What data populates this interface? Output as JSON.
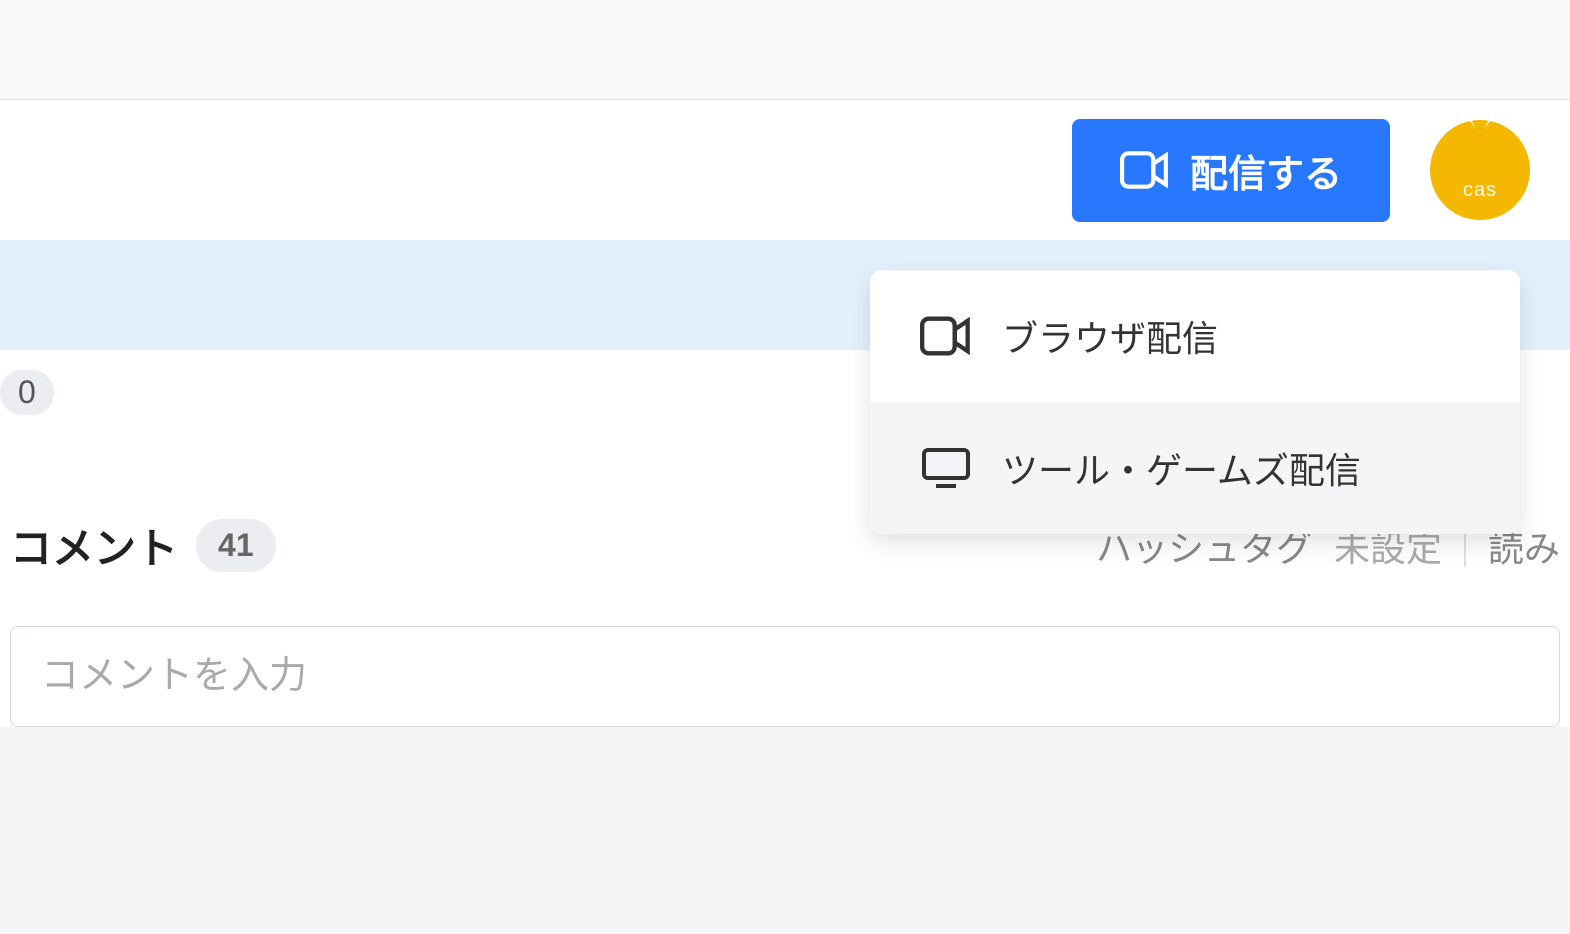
{
  "header": {
    "broadcast_label": "配信する",
    "avatar_text": "cas"
  },
  "dropdown": {
    "items": [
      {
        "label": "ブラウザ配信",
        "icon": "camera"
      },
      {
        "label": "ツール・ゲームズ配信",
        "icon": "monitor"
      }
    ]
  },
  "badge": {
    "value": "0"
  },
  "comments": {
    "title": "コメント",
    "count": "41",
    "hashtag_label": "ハッシュタグ",
    "hashtag_value": "未設定",
    "read_label": "読み",
    "input_placeholder": "コメントを入力"
  }
}
